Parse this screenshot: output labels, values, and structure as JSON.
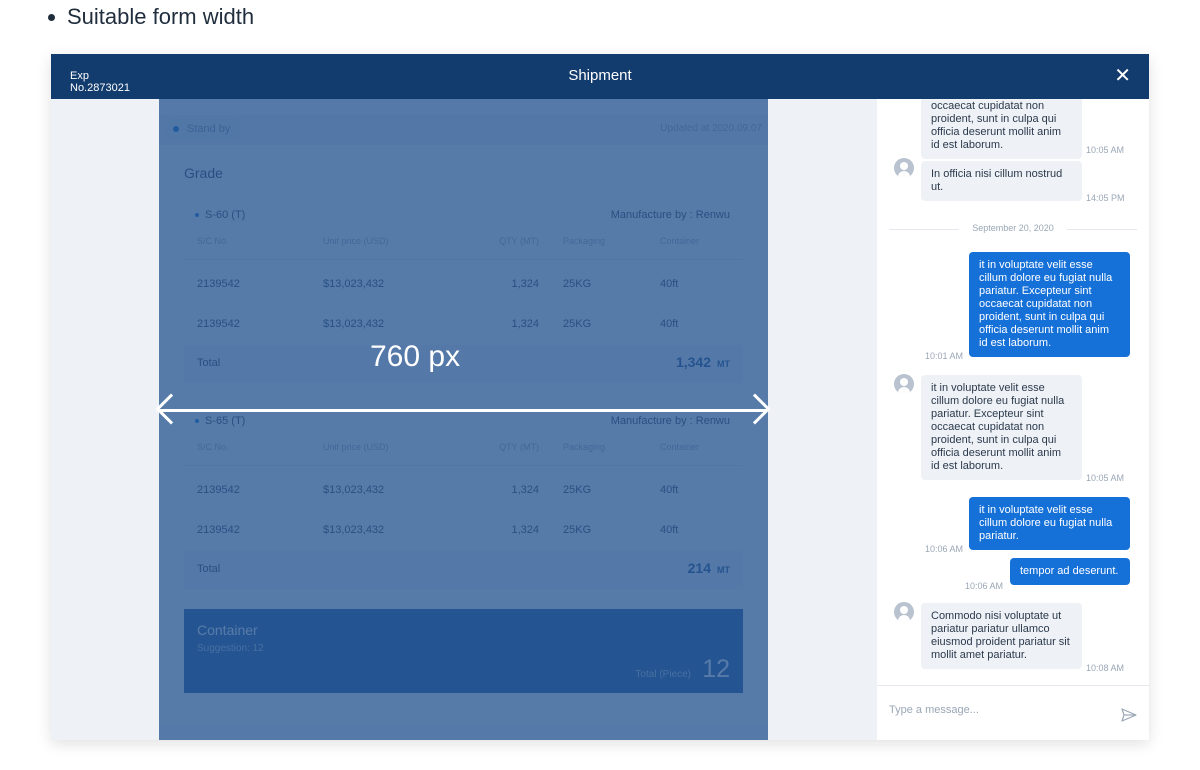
{
  "page": {
    "heading": "Suitable form width"
  },
  "window": {
    "exp_label": "Exp",
    "exp_no": "No.2873021",
    "title": "Shipment",
    "close_icon": "✕"
  },
  "form": {
    "status": "Stand by",
    "updated": "Updated at 2020.09.07",
    "grade_title": "Grade",
    "columns": [
      "S/C No.",
      "Unit price (USD)",
      "QTY (MT)",
      "Packaging",
      "Container"
    ],
    "groups": [
      {
        "name": "S-60 (T)",
        "manufacture": "Manufacture by : Renwu",
        "rows": [
          [
            "2139542",
            "$13,023,432",
            "1,324",
            "25KG",
            "40ft"
          ],
          [
            "2139542",
            "$13,023,432",
            "1,324",
            "25KG",
            "40ft"
          ]
        ],
        "total_label": "Total",
        "total_value": "1,342",
        "total_unit": "MT"
      },
      {
        "name": "S-65 (T)",
        "manufacture": "Manufacture by : Renwu",
        "rows": [
          [
            "2139542",
            "$13,023,432",
            "1,324",
            "25KG",
            "40ft"
          ],
          [
            "2139542",
            "$13,023,432",
            "1,324",
            "25KG",
            "40ft"
          ]
        ],
        "total_label": "Total",
        "total_value": "214",
        "total_unit": "MT"
      }
    ],
    "container": {
      "title": "Container",
      "suggestion": "Suggestion: 12",
      "total_label": "Total (Piece)",
      "total_value": "12"
    }
  },
  "annotation": {
    "width_label": "760 px"
  },
  "chat": {
    "messages": [
      {
        "text": "occaecat cupidatat non proident, sunt in culpa qui officia deserunt mollit anim id est laborum.",
        "time": "10:05 AM"
      },
      {
        "text": "In officia nisi cillum nostrud ut.",
        "time": "14:05 PM"
      },
      {
        "text": "it in voluptate velit esse cillum dolore eu fugiat nulla pariatur. Excepteur sint occaecat cupidatat non proident, sunt in culpa qui officia deserunt mollit anim id est laborum.",
        "time": "10:01 AM"
      },
      {
        "text": "it in voluptate velit esse cillum dolore eu fugiat nulla pariatur. Excepteur sint occaecat cupidatat non proident, sunt in culpa qui officia deserunt mollit anim id est laborum.",
        "time": "10:05 AM"
      },
      {
        "text": "it in voluptate velit esse cillum dolore eu fugiat nulla pariatur.",
        "time": "10:06 AM"
      },
      {
        "text": "tempor ad deserunt.",
        "time": "10:06 AM"
      },
      {
        "text": "Commodo nisi voluptate ut pariatur pariatur ullamco eiusmod proident pariatur sit mollit amet pariatur.",
        "time": "10:08 AM"
      }
    ],
    "date_divider": "September 20, 2020",
    "input_placeholder": "Type a message...",
    "send_icon": "send-icon"
  },
  "colors": {
    "header": "#123b6e",
    "accent": "#1570d8",
    "overlay": "#285691"
  }
}
